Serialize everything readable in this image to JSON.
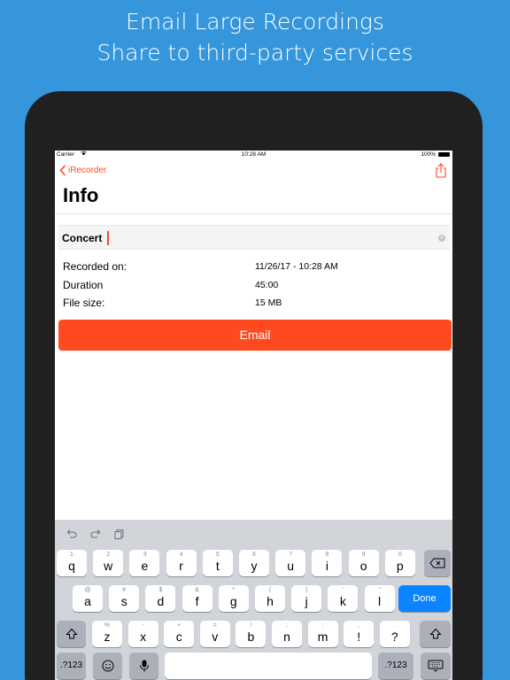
{
  "banner": {
    "line1": "Email Large Recordings",
    "line2": "Share to third-party services"
  },
  "status_bar": {
    "carrier": "Carrier",
    "time": "10:28 AM",
    "battery": "100%"
  },
  "nav": {
    "back_label": "iRecorder",
    "title": "Info"
  },
  "name_field": {
    "value": "Concert"
  },
  "details": [
    {
      "label": "Recorded on:",
      "value": "11/26/17 - 10:28 AM"
    },
    {
      "label": "Duration",
      "value": "45:00"
    },
    {
      "label": "File size:",
      "value": "15 MB"
    }
  ],
  "email_button": "Email",
  "keyboard": {
    "row1": [
      {
        "main": "q",
        "hint": "1"
      },
      {
        "main": "w",
        "hint": "2"
      },
      {
        "main": "e",
        "hint": "3"
      },
      {
        "main": "r",
        "hint": "4"
      },
      {
        "main": "t",
        "hint": "5"
      },
      {
        "main": "y",
        "hint": "6"
      },
      {
        "main": "u",
        "hint": "7"
      },
      {
        "main": "i",
        "hint": "8"
      },
      {
        "main": "o",
        "hint": "9"
      },
      {
        "main": "p",
        "hint": "0"
      }
    ],
    "row2": [
      {
        "main": "a",
        "hint": "@"
      },
      {
        "main": "s",
        "hint": "#"
      },
      {
        "main": "d",
        "hint": "$"
      },
      {
        "main": "f",
        "hint": "&"
      },
      {
        "main": "g",
        "hint": "*"
      },
      {
        "main": "h",
        "hint": "("
      },
      {
        "main": "j",
        "hint": ")"
      },
      {
        "main": "k",
        "hint": "'"
      },
      {
        "main": "l",
        "hint": "\""
      }
    ],
    "row3": [
      {
        "main": "z",
        "hint": "%"
      },
      {
        "main": "x",
        "hint": "-"
      },
      {
        "main": "c",
        "hint": "+"
      },
      {
        "main": "v",
        "hint": "="
      },
      {
        "main": "b",
        "hint": "/"
      },
      {
        "main": "n",
        "hint": ";"
      },
      {
        "main": "m",
        "hint": ":"
      },
      {
        "main": "!",
        "hint": ","
      },
      {
        "main": "?",
        "hint": "."
      }
    ],
    "done_label": "Done",
    "numbers_label": ".?123",
    "icons": {
      "undo": "undo-icon",
      "redo": "redo-icon",
      "paste": "clipboard-icon",
      "delete": "backspace-icon",
      "shift": "shift-icon",
      "emoji": "emoji-icon",
      "mic": "microphone-icon",
      "hide": "keyboard-hide-icon"
    }
  },
  "colors": {
    "background": "#3596db",
    "accent": "#ff4a1f",
    "done_key": "#0a84ff",
    "keyboard_bg": "#d1d4d9"
  }
}
